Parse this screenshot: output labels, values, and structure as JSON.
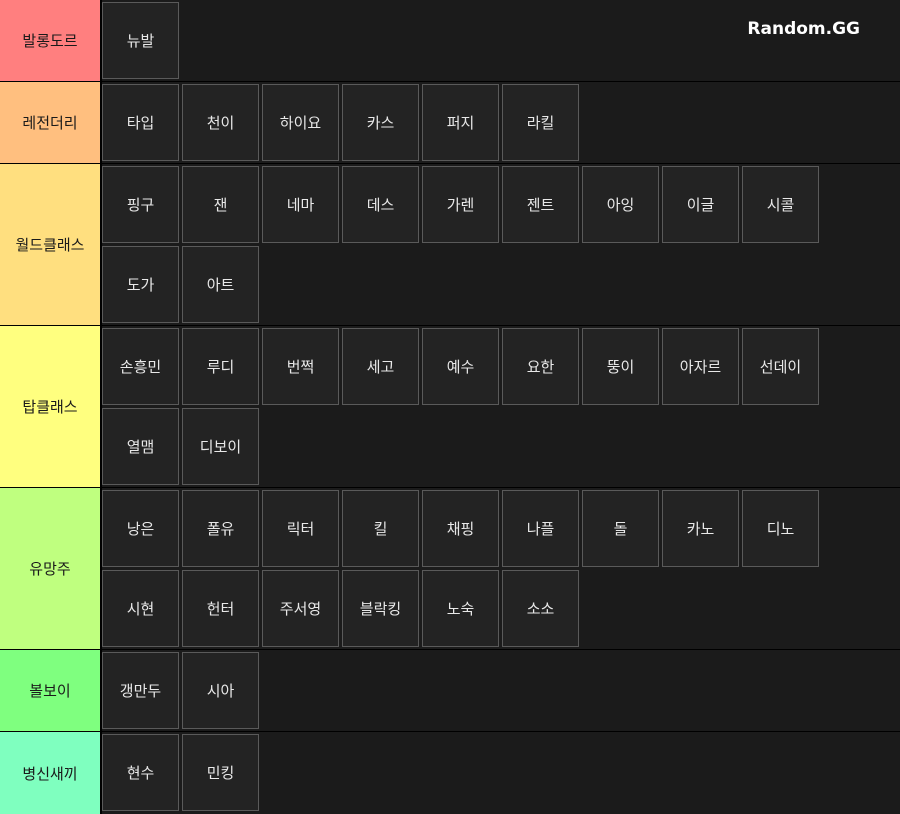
{
  "watermark": "Random.GG",
  "tiers": [
    {
      "label": "발롱도르",
      "color": "#ff7f7f",
      "items": [
        "뉴발"
      ]
    },
    {
      "label": "레전더리",
      "color": "#ffbf7f",
      "items": [
        "타입",
        "천이",
        "하이요",
        "카스",
        "퍼지",
        "라킬"
      ]
    },
    {
      "label": "월드클래스",
      "color": "#ffdf7f",
      "items": [
        "핑구",
        "잰",
        "네마",
        "데스",
        "가렌",
        "젠트",
        "아잉",
        "이글",
        "시콜",
        "도가",
        "아트"
      ]
    },
    {
      "label": "탑클래스",
      "color": "#ffff7f",
      "items": [
        "손흥민",
        "루디",
        "번쩍",
        "세고",
        "예수",
        "요한",
        "뚱이",
        "아자르",
        "선데이",
        "열맴",
        "디보이"
      ]
    },
    {
      "label": "유망주",
      "color": "#bfff7f",
      "items": [
        "낭은",
        "폴유",
        "릭터",
        "킬",
        "채핑",
        "나플",
        "돌",
        "카노",
        "디노",
        "시현",
        "헌터",
        "주서영",
        "블락킹",
        "노숙",
        "소소"
      ]
    },
    {
      "label": "볼보이",
      "color": "#7fff7f",
      "items": [
        "갱만두",
        "시아"
      ]
    },
    {
      "label": "병신새끼",
      "color": "#7fffbf",
      "items": [
        "현수",
        "민킹"
      ]
    }
  ]
}
